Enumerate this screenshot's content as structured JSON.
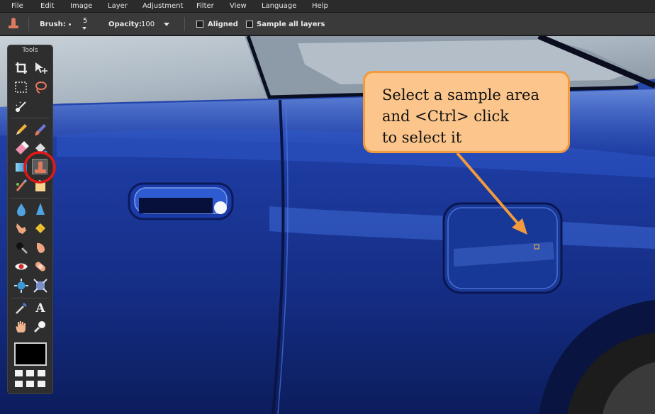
{
  "menubar": {
    "items": [
      "File",
      "Edit",
      "Image",
      "Layer",
      "Adjustment",
      "Filter",
      "View",
      "Language",
      "Help"
    ]
  },
  "options": {
    "tool_icon": "clone-stamp-icon",
    "brush_label": "Brush:",
    "brush_size": "5",
    "opacity_label": "Opacity:",
    "opacity_value": "100",
    "aligned_label": "Aligned",
    "aligned_checked": false,
    "sample_all_label": "Sample all layers",
    "sample_all_checked": false
  },
  "tools": {
    "title": "Tools",
    "items": [
      {
        "name": "crop-icon"
      },
      {
        "name": "move-icon"
      },
      {
        "name": "marquee-select-icon"
      },
      {
        "name": "lasso-icon"
      },
      {
        "name": "magic-wand-icon"
      },
      {
        "name": "pencil-icon"
      },
      {
        "name": "brush-icon"
      },
      {
        "name": "eraser-icon"
      },
      {
        "name": "paint-bucket-icon"
      },
      {
        "name": "gradient-icon"
      },
      {
        "name": "clone-stamp-icon",
        "active": true
      },
      {
        "name": "color-replace-icon"
      },
      {
        "name": "drawing-icon"
      },
      {
        "name": "blur-icon"
      },
      {
        "name": "sharpen-icon"
      },
      {
        "name": "smudge-icon"
      },
      {
        "name": "sponge-icon"
      },
      {
        "name": "dodge-icon"
      },
      {
        "name": "burn-icon"
      },
      {
        "name": "red-eye-icon"
      },
      {
        "name": "spot-heal-icon"
      },
      {
        "name": "bloat-icon"
      },
      {
        "name": "pinch-icon"
      },
      {
        "name": "color-picker-icon"
      },
      {
        "name": "type-icon"
      },
      {
        "name": "hand-icon"
      },
      {
        "name": "zoom-icon"
      }
    ],
    "type_glyph": "A",
    "foreground_color": "#000000"
  },
  "callout": {
    "text": "Select a sample area\nand <Ctrl> click\nto select it"
  },
  "colors": {
    "callout_fill": "#fbc58b",
    "callout_border": "#f29a3c",
    "highlight_ring": "#e01818",
    "car_blue": "#17338f"
  }
}
